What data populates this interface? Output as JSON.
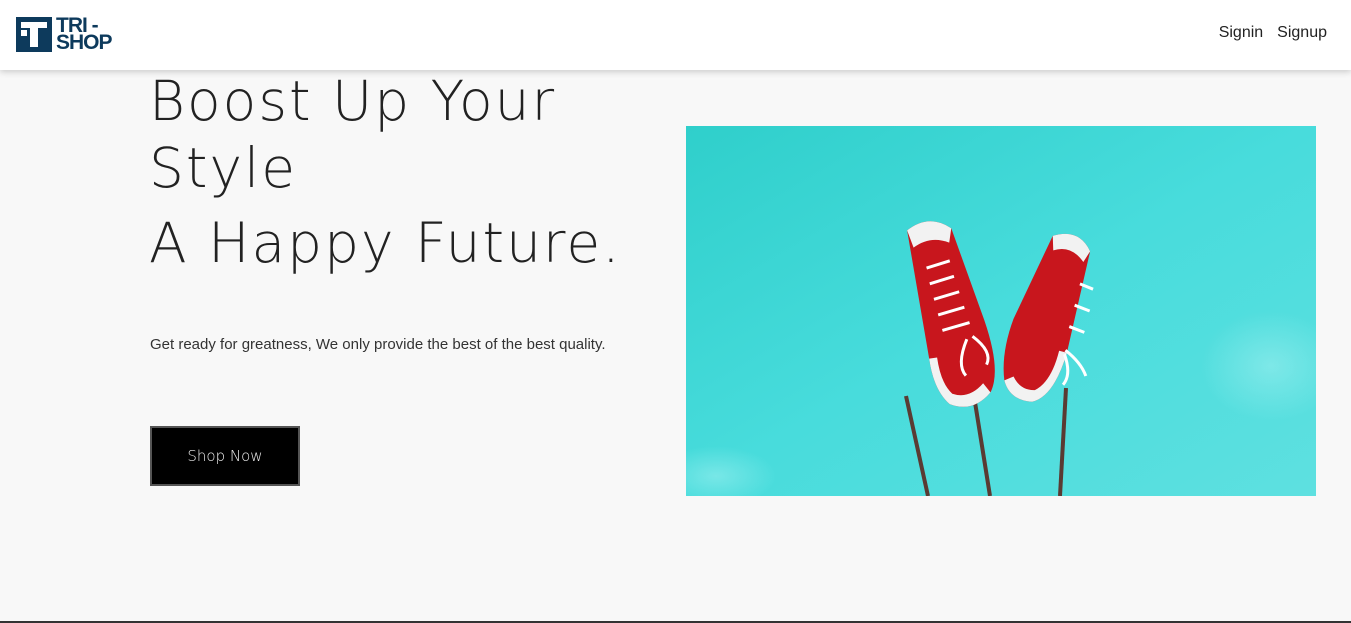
{
  "brand": {
    "line1": "TRI -",
    "line2": "SHOP",
    "color": "#0d3a5c"
  },
  "nav": {
    "signin": "Signin",
    "signup": "Signup"
  },
  "hero": {
    "title_line1": "Boost Up Your",
    "title_line2": "Style",
    "title_line3": "A Happy Future.",
    "subtitle": "Get ready for greatness, We only provide the best of the best quality.",
    "cta": "Shop Now"
  },
  "colors": {
    "sky": "#3fd6d6",
    "shoe": "#c8161d",
    "button_bg": "#000000"
  }
}
